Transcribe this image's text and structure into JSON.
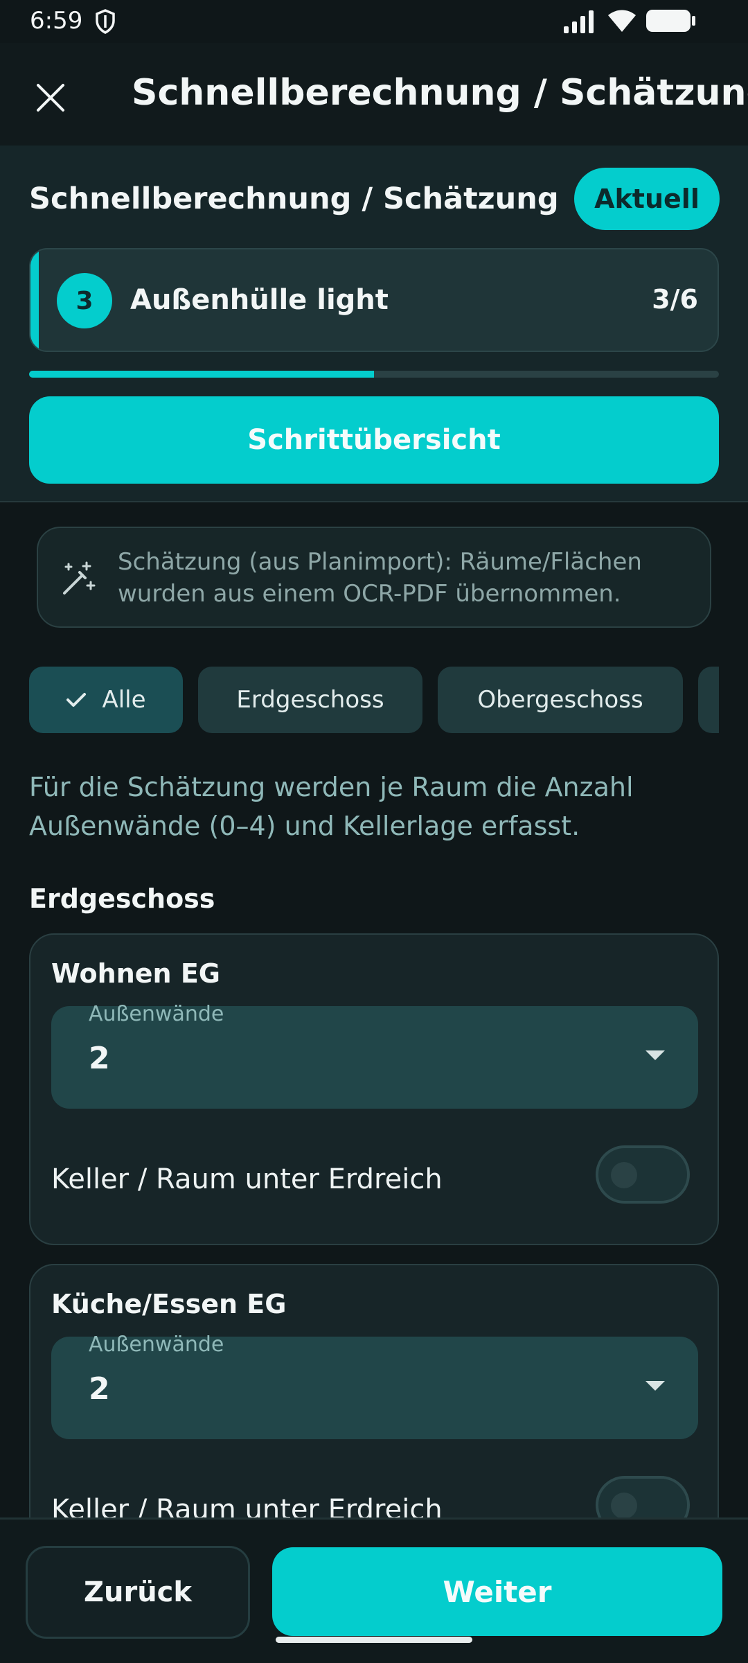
{
  "status_bar": {
    "time": "6:59"
  },
  "app_bar": {
    "title": "Schnellberechnung / Schätzung"
  },
  "header": {
    "title": "Schnellberechnung / Schätzung",
    "badge_label": "Aktuell",
    "step": {
      "number": "3",
      "name": "Außenhülle light",
      "counter": "3/6"
    },
    "progress_fraction": 0.5,
    "overview_button_label": "Schrittübersicht"
  },
  "info_banner": {
    "text": "Schätzung (aus Planimport): Räume/Flächen wurden aus einem OCR-PDF übernommen."
  },
  "filters": {
    "chips": [
      {
        "label": "Alle",
        "selected": true
      },
      {
        "label": "Erdgeschoss",
        "selected": false
      },
      {
        "label": "Obergeschoss",
        "selected": false
      }
    ]
  },
  "hint": "Für die Schätzung werden je Raum die Anzahl Außenwände (0–4) und Kellerlage erfasst.",
  "section": {
    "heading": "Erdgeschoss",
    "rooms": [
      {
        "name": "Wohnen EG",
        "field_label": "Außenwände",
        "field_value": "2",
        "toggle_label": "Keller / Raum unter Erdreich",
        "toggle_on": false
      },
      {
        "name": "Küche/Essen EG",
        "field_label": "Außenwände",
        "field_value": "2",
        "toggle_label": "Keller / Raum unter Erdreich",
        "toggle_on": false
      }
    ]
  },
  "bottom_bar": {
    "back_label": "Zurück",
    "next_label": "Weiter"
  },
  "colors": {
    "accent": "#04cdcd",
    "background": "#0f1719",
    "card": "#172528",
    "field": "#214649"
  },
  "icons": {
    "close": "close-icon",
    "info": "magic-wand-icon",
    "chip_check": "check-icon",
    "dropdown": "chevron-down-icon"
  }
}
